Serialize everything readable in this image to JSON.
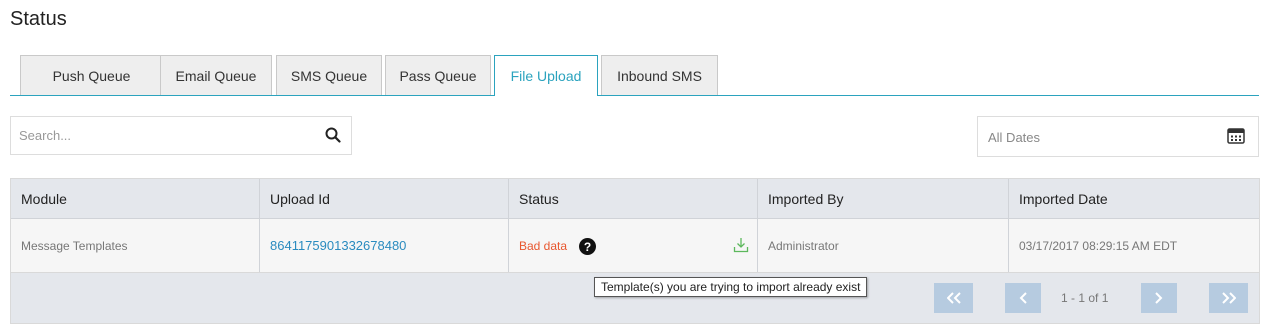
{
  "page": {
    "title": "Status"
  },
  "tabs": [
    {
      "label": "Push  Queue",
      "active": false
    },
    {
      "label": "Email Queue",
      "active": false
    },
    {
      "label": "SMS Queue",
      "active": false
    },
    {
      "label": "Pass Queue",
      "active": false
    },
    {
      "label": "File Upload",
      "active": true
    },
    {
      "label": "Inbound SMS",
      "active": false
    }
  ],
  "search": {
    "placeholder": "Search...",
    "value": "",
    "icon": "search-icon"
  },
  "date_filter": {
    "value": "All Dates",
    "icon": "calendar-icon"
  },
  "table": {
    "columns": [
      "Module",
      "Upload Id",
      "Status",
      "Imported By",
      "Imported Date"
    ],
    "rows": [
      {
        "module": "Message Templates",
        "upload_id": "8641175901332678480",
        "status": "Bad data",
        "imported_by": "Administrator",
        "imported_date": "03/17/2017 08:29:15 AM EDT"
      }
    ]
  },
  "pager": {
    "text": "1 - 1 of 1",
    "first_icon": "double-chevron-left-icon",
    "prev_icon": "chevron-left-icon",
    "next_icon": "chevron-right-icon",
    "last_icon": "double-chevron-right-icon"
  },
  "tooltip": {
    "text": "Template(s) you are trying to import already exist"
  },
  "colors": {
    "accent": "#2ba3be",
    "link": "#2a8bbf",
    "error": "#e8572f",
    "download": "#5cb85c",
    "pager_button": "#b6cbe0"
  }
}
